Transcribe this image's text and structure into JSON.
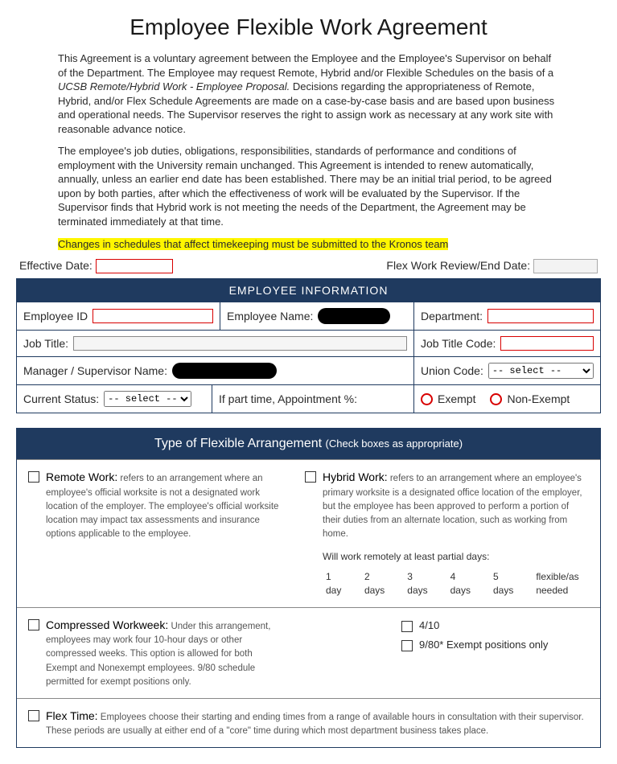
{
  "title": "Employee Flexible Work Agreement",
  "intro": {
    "p1a": "This Agreement is a voluntary agreement between the Employee and the Employee's Supervisor on behalf of the Department. The Employee may request Remote, Hybrid and/or Flexible Schedules on the basis of a ",
    "p1_italic": "UCSB Remote/Hybrid Work - Employee Proposal.",
    "p1b": " Decisions regarding the appropriateness of Remote, Hybrid, and/or Flex Schedule Agreements are made on a case-by-case basis and are based upon business and operational needs. The Supervisor reserves the right to assign work as necessary at any work site with reasonable advance notice.",
    "p2": " The employee's job duties, obligations, responsibilities, standards of performance and conditions of employment with the University remain unchanged. This Agreement is intended to renew automatically, annually, unless an earlier end date has been established.  There may be an initial trial period, to be agreed upon by both parties, after which the effectiveness of work will be evaluated by the Supervisor. If the Supervisor finds that Hybrid work is not meeting the needs of the Department, the Agreement may be terminated immediately at that time.",
    "highlight": "Changes in schedules that affect timekeeping must be submitted to the Kronos team"
  },
  "dates": {
    "effective_label": "Effective Date:",
    "review_label": "Flex Work Review/End Date:"
  },
  "emp_info": {
    "header": "EMPLOYEE INFORMATION",
    "id_label": "Employee ID",
    "name_label": "Employee Name:",
    "dept_label": "Department:",
    "jobtitle_label": "Job Title:",
    "jobcode_label": "Job Title Code:",
    "mgr_label": "Manager / Supervisor Name:",
    "union_label": "Union Code:",
    "union_select": "-- select --",
    "status_label": "Current Status:",
    "status_select": "-- select --",
    "parttime_label": "If part time, Appointment %:",
    "exempt_label": "Exempt",
    "nonexempt_label": "Non-Exempt"
  },
  "flex_arr": {
    "header": "Type of Flexible Arrangement",
    "header_sub": "(Check boxes as appropriate)",
    "remote": {
      "head": "Remote Work:",
      "body": " refers to an arrangement where an employee's official worksite is not a designated work location of the employer. The employee's official worksite location may impact tax assessments and insurance options applicable to the employee."
    },
    "hybrid": {
      "head": "Hybrid Work:",
      "body": " refers to an arrangement where an employee's primary worksite is a designated office location of the employer, but the employee has been approved to perform a portion of their duties from an alternate location, such as working from home.",
      "days_label": "Will work remotely at least partial days:",
      "days": [
        "1 day",
        "2 days",
        "3 days",
        "4 days",
        "5 days",
        "flexible/as needed"
      ]
    },
    "compressed": {
      "head": "Compressed Workweek:",
      "body": " Under this arrangement, employees may work four 10-hour days or other compressed weeks. This option is allowed for both Exempt and Nonexempt employees. 9/80 schedule permitted for exempt positions only.",
      "opt1": "4/10",
      "opt2": "9/80* Exempt positions only"
    },
    "flextime": {
      "head": "Flex Time:",
      "body": " Employees choose their starting and ending times from a range of available hours in consultation with their supervisor. These periods are usually at either end of a \"core\" time during which most department business takes place."
    }
  }
}
